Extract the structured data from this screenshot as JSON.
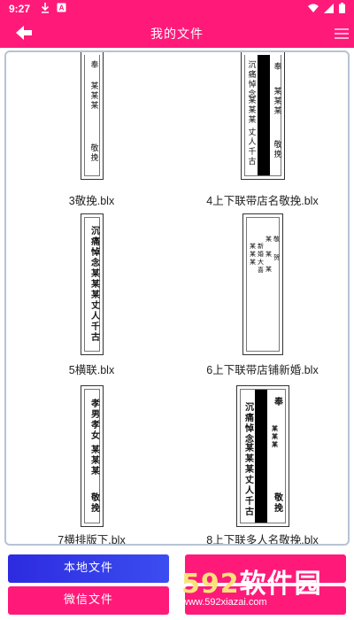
{
  "status_bar": {
    "time": "9:27",
    "left_icons": [
      "download-icon",
      "a-badge-icon"
    ],
    "right_icons": [
      "wifi-icon",
      "signal-icon",
      "battery-icon"
    ]
  },
  "header": {
    "title": "我的文件",
    "back_icon": "arrow-left-icon",
    "menu_icon": "menu-icon",
    "color": "#ff1a7a"
  },
  "files": [
    {
      "name": "3敬挽.blx",
      "columns": [
        {
          "text": "奉",
          "bold": false
        },
        {
          "text": "某某某",
          "bold": false
        },
        {
          "text": "敬挽",
          "bold": false
        }
      ]
    },
    {
      "name": "4上下联带店名敬挽.blx",
      "columns": [
        {
          "text": "沉痛悼念",
          "bold": false
        },
        {
          "text": "某某某",
          "bold": false
        },
        {
          "text": "丈人千古",
          "bold": false
        },
        {
          "text": "奉",
          "bold": false
        },
        {
          "text": "某某某",
          "bold": false
        },
        {
          "text": "敬挽",
          "bold": false
        }
      ]
    },
    {
      "name": "5横联.blx",
      "columns": [
        {
          "text": "沉痛悼念某某某丈人千古",
          "bold": true
        }
      ]
    },
    {
      "name": "6上下联带店铺新婚.blx",
      "columns": [
        {
          "text": "某某某",
          "bold": false
        },
        {
          "text": "新婚大喜",
          "bold": false
        },
        {
          "text": "某某某",
          "bold": false
        },
        {
          "text": "敬贺",
          "bold": false
        }
      ]
    },
    {
      "name": "7横排版下.blx",
      "columns": [
        {
          "text": "孝男孝女",
          "bold": true
        },
        {
          "text": "某某某",
          "bold": true
        },
        {
          "text": "敬挽",
          "bold": true
        }
      ]
    },
    {
      "name": "8上下联多人名敬挽.blx",
      "columns": [
        {
          "text": "沉痛悼念",
          "bold": true
        },
        {
          "text": "某某某",
          "bold": true
        },
        {
          "text": "丈人千古",
          "bold": true
        },
        {
          "text": "奉",
          "bold": true
        },
        {
          "text": "某某某",
          "bold": true
        },
        {
          "text": "敬挽",
          "bold": true
        }
      ]
    }
  ],
  "buttons": {
    "local_files": "本地文件",
    "wechat_files": "微信文件"
  },
  "watermark": {
    "brand_num": "592",
    "brand_text": "软件园",
    "url": "www.592xiazai.com"
  }
}
